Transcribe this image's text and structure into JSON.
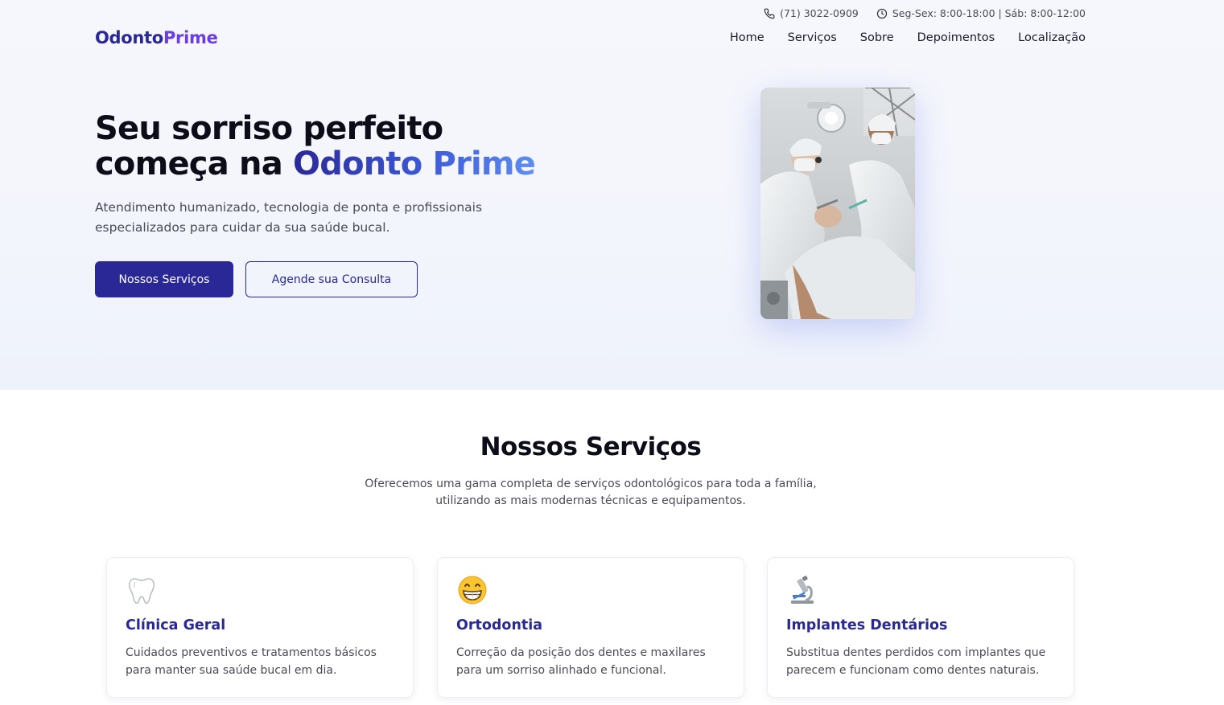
{
  "topbar": {
    "phone": "(71) 3022-0909",
    "hours": "Seg-Sex: 8:00-18:00 | Sáb: 8:00-12:00"
  },
  "logo": {
    "part1": "Odonto",
    "part2": "Prime"
  },
  "nav": {
    "items": [
      {
        "label": "Home"
      },
      {
        "label": "Serviços"
      },
      {
        "label": "Sobre"
      },
      {
        "label": "Depoimentos"
      },
      {
        "label": "Localização"
      }
    ]
  },
  "hero": {
    "title_line1": "Seu sorriso perfeito",
    "title_line2_prefix": "começa na ",
    "title_accent": "Odonto Prime",
    "subtitle": "Atendimento humanizado, tecnologia de ponta e profissionais especializados para cuidar da sua saúde bucal.",
    "primary_button": "Nossos Serviços",
    "secondary_button": "Agende sua Consulta"
  },
  "services": {
    "title": "Nossos Serviços",
    "subtitle_line1": "Oferecemos uma gama completa de serviços odontológicos para toda a família,",
    "subtitle_line2": "utilizando as mais modernas técnicas e equipamentos.",
    "cards": [
      {
        "icon": "tooth-icon",
        "title": "Clínica Geral",
        "description": "Cuidados preventivos e tratamentos básicos para manter sua saúde bucal em dia."
      },
      {
        "icon": "grinning-face-icon",
        "title": "Ortodontia",
        "description": "Correção da posição dos dentes e maxilares para um sorriso alinhado e funcional."
      },
      {
        "icon": "microscope-icon",
        "title": "Implantes Dentários",
        "description": "Substitua dentes perdidos com implantes que parecem e funcionam como dentes naturais."
      }
    ]
  },
  "colors": {
    "brand_primary": "#2a2896",
    "brand_secondary": "#6a3ee0",
    "accent_gradient_end": "#5d8ef0",
    "hero_background": "#f4f6fc"
  }
}
